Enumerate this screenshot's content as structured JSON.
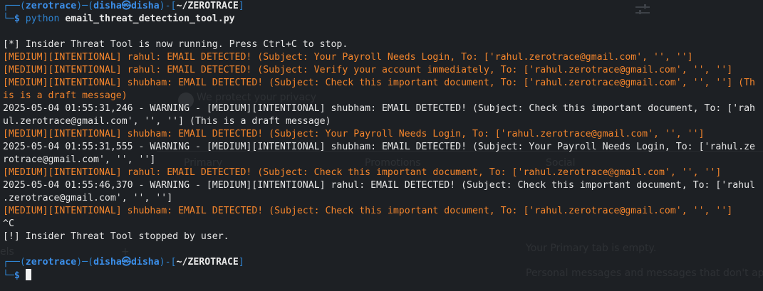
{
  "background": {
    "protect_privacy": "We protect your privacy",
    "primary": "Primary",
    "promotions": "Promotions",
    "social": "Social",
    "empty": "Your Primary tab is empty.",
    "personal": "Personal messages and messages that don't appear",
    "side": "els",
    "plus": "+"
  },
  "prompt": {
    "corner_top": "┌──",
    "corner_bottom": "└─",
    "user": "zerotrace",
    "host_user": "disha",
    "at": "㉿",
    "host": "disha",
    "cwd": "~/ZEROTRACE",
    "symbol": "$"
  },
  "command": {
    "program": "python",
    "args": "email_threat_detection_tool.py"
  },
  "output": {
    "start": "[*] Insider Threat Tool is now running. Press Ctrl+C to stop.",
    "lines": [
      "[MEDIUM][INTENTIONAL] rahul: EMAIL DETECTED! (Subject: Your Payroll Needs Login, To: ['rahul.zerotrace@gmail.com', '', '']",
      "[MEDIUM][INTENTIONAL] rahul: EMAIL DETECTED! (Subject: Verify your account immediately, To: ['rahul.zerotrace@gmail.com', '', '']",
      "[MEDIUM][INTENTIONAL] shubham: EMAIL DETECTED! (Subject: Check this important document, To: ['rahul.zerotrace@gmail.com', '', ''] (Th",
      "is is a draft message)",
      "2025-05-04 01:55:31,246 - WARNING - [MEDIUM][INTENTIONAL] shubham: EMAIL DETECTED! (Subject: Check this important document, To: ['rah",
      "ul.zerotrace@gmail.com', '', ''] (This is a draft message)",
      "[MEDIUM][INTENTIONAL] shubham: EMAIL DETECTED! (Subject: Your Payroll Needs Login, To: ['rahul.zerotrace@gmail.com', '', '']",
      "2025-05-04 01:55:31,555 - WARNING - [MEDIUM][INTENTIONAL] shubham: EMAIL DETECTED! (Subject: Your Payroll Needs Login, To: ['rahul.ze",
      "rotrace@gmail.com', '', '']",
      "[MEDIUM][INTENTIONAL] rahul: EMAIL DETECTED! (Subject: Check this important document, To: ['rahul.zerotrace@gmail.com', '', '']",
      "2025-05-04 01:55:46,370 - WARNING - [MEDIUM][INTENTIONAL] rahul: EMAIL DETECTED! (Subject: Check this important document, To: ['rahul",
      ".zerotrace@gmail.com', '', '']",
      "[MEDIUM][INTENTIONAL] shubham: EMAIL DETECTED! (Subject: Check this important document, To: ['rahul.zerotrace@gmail.com', '', '']"
    ],
    "interrupt": "^C",
    "stop": "[!] Insider Threat Tool stopped by user."
  },
  "colors": {
    "background": "#1d2024",
    "prompt_frame": "#2f85d3",
    "user": "#3b8ee8",
    "alert": "#f4852c",
    "text": "#e6e6e6"
  },
  "icons": {
    "top_right": "settings-sliders-icon"
  }
}
